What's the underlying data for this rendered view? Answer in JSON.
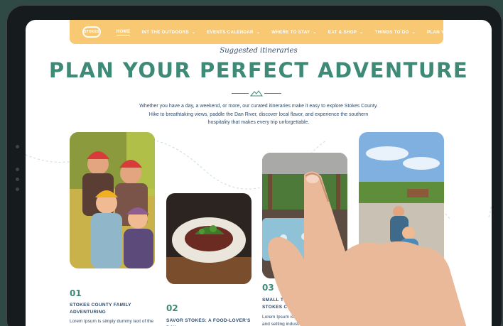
{
  "nav": {
    "logo": "STOKES",
    "items": [
      {
        "label": "HOME",
        "active": true,
        "dropdown": false
      },
      {
        "label": "INT THE OUTDOORS",
        "dropdown": true
      },
      {
        "label": "EVENTS CALENDAR",
        "dropdown": true
      },
      {
        "label": "WHERE TO STAY",
        "dropdown": true
      },
      {
        "label": "EAT & SHOP",
        "dropdown": true
      },
      {
        "label": "THINGS TO DO",
        "dropdown": true
      },
      {
        "label": "PLAN YOUR VISIT",
        "dropdown": true
      }
    ]
  },
  "hero": {
    "eyebrow": "Suggested itineraries",
    "headline": "PLAN YOUR PERFECT ADVENTURE",
    "intro": "Whether you have a day, a weekend, or more, our curated itineraries make it easy to explore Stokes County. Hike to breathtaking views, paddle the Dan River, discover local flavor, and experience the southern hospitality that makes every trip unforgettable."
  },
  "cards": [
    {
      "number": "01",
      "title": "STOKES COUNTY FAMILY ADVENTURING",
      "text": "Lorem Ipsum is simply dummy text of the"
    },
    {
      "number": "02",
      "title": "SAVOR STOKES: A FOOD-LOVER'S DAY",
      "text": ""
    },
    {
      "number": "03",
      "title": "SMALL TOWN COMFO... DAY IN STOKES COUNTY",
      "text": "Lorem Ipsum is simply dumm... printing and setting industry."
    }
  ],
  "colors": {
    "accent": "#3e8a77",
    "nav": "#f8c873",
    "text": "#2d4a6b"
  }
}
